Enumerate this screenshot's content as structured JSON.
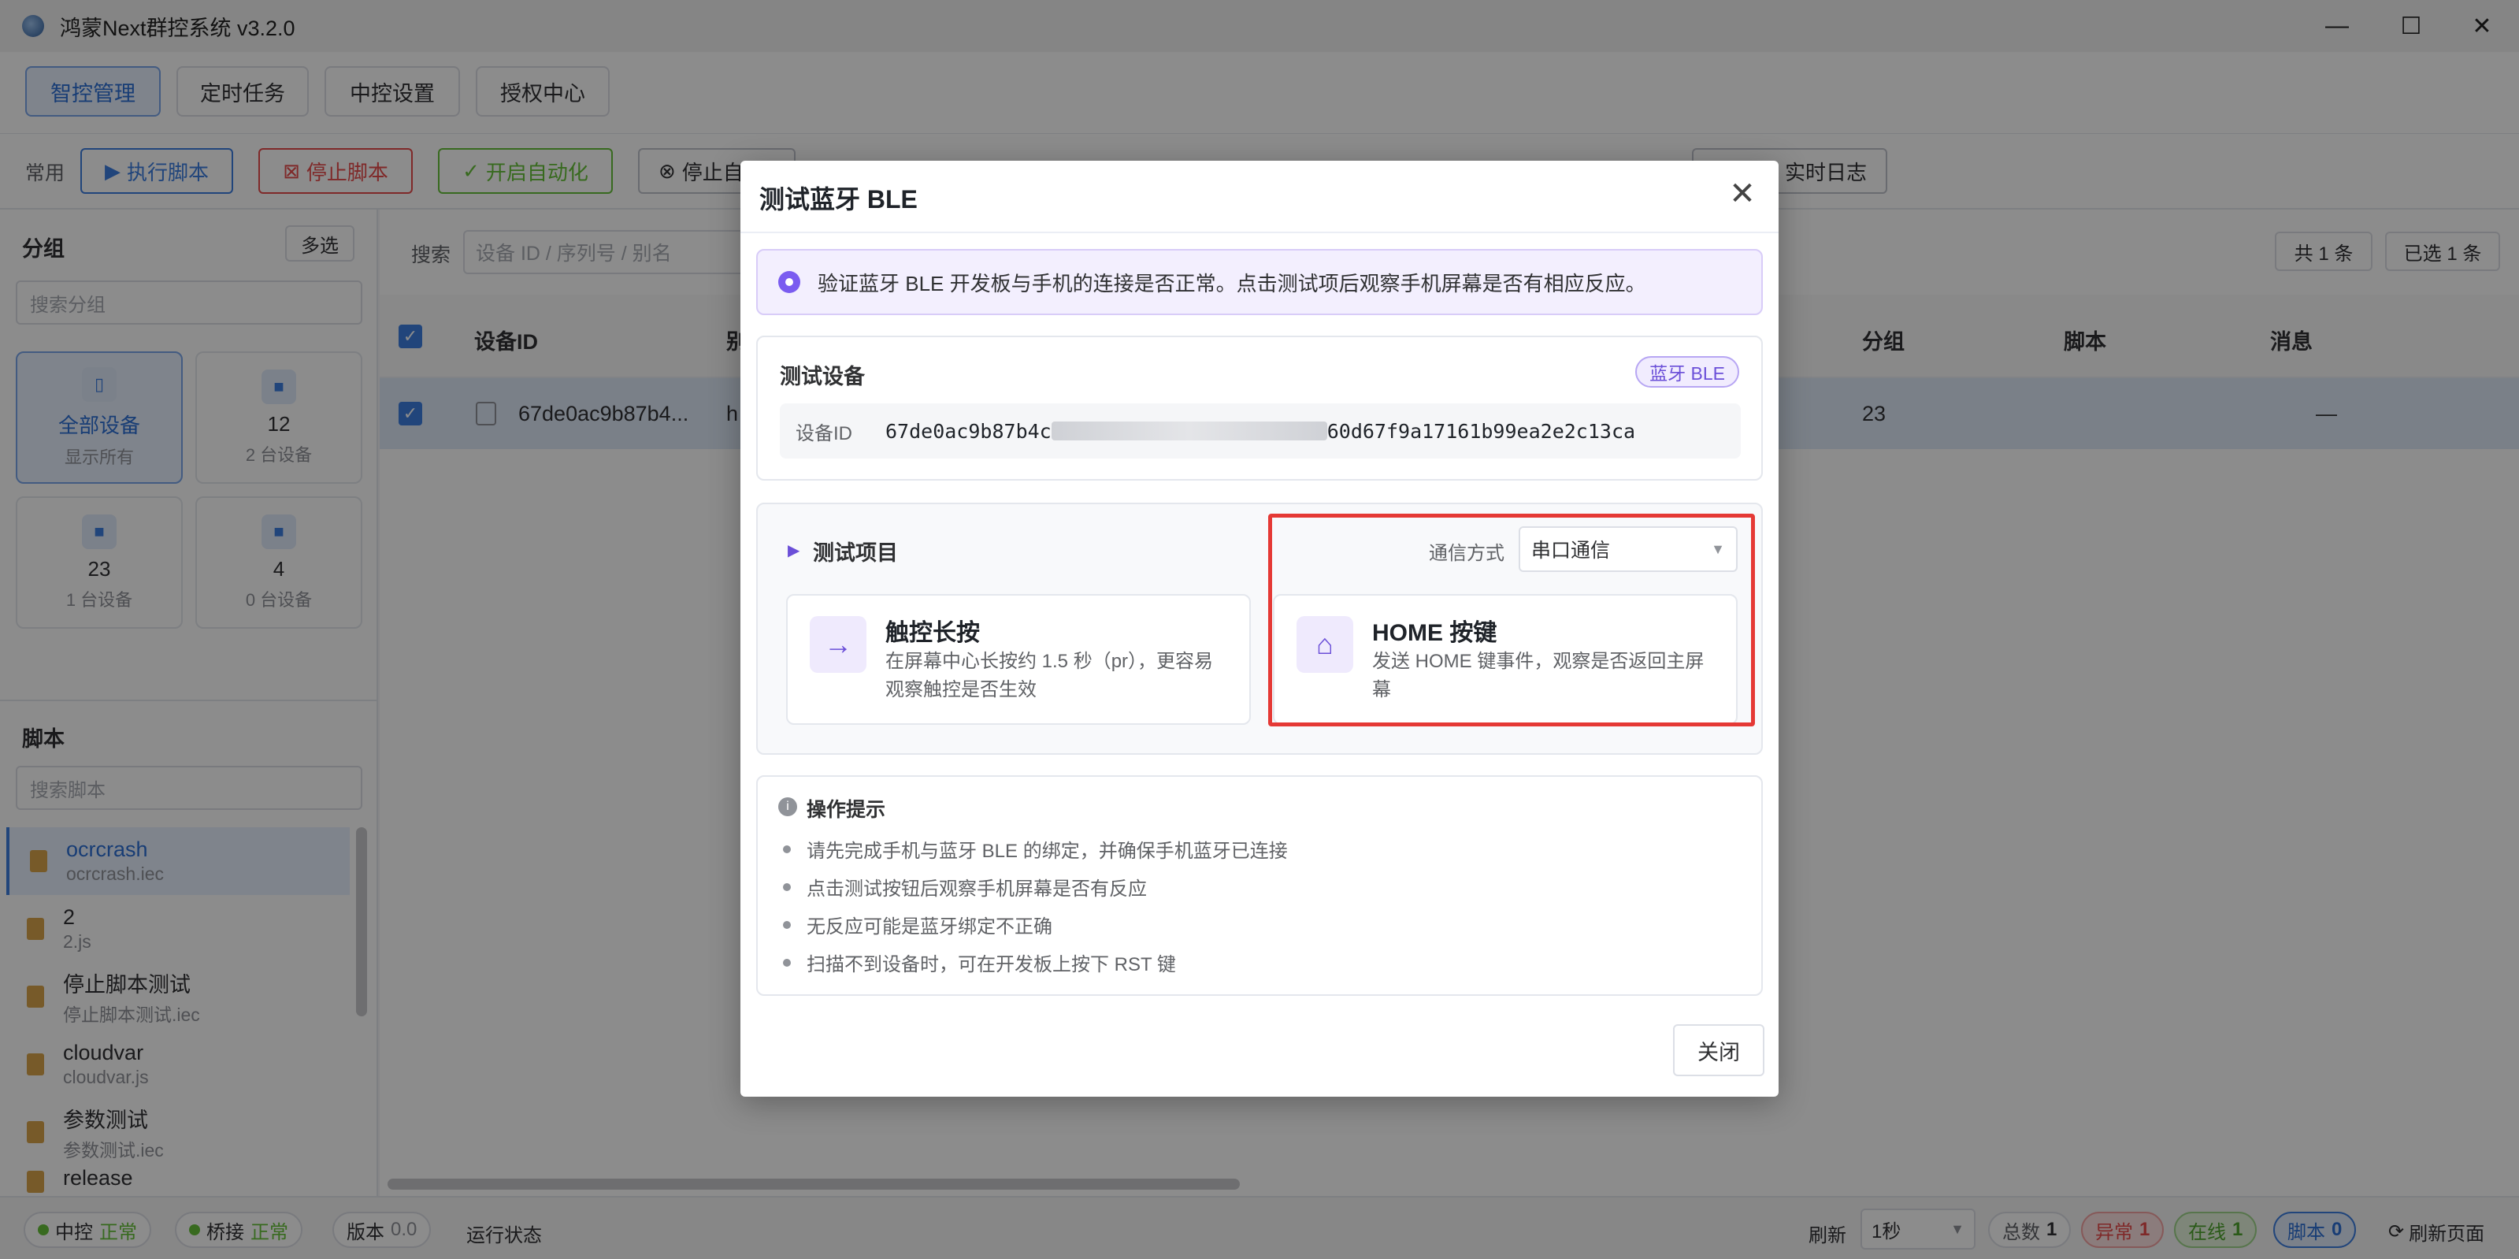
{
  "window": {
    "title": "鸿蒙Next群控系统 v3.2.0",
    "controls": {
      "minimize": "—",
      "maximize": "☐",
      "close": "✕"
    }
  },
  "nav": {
    "tabs": [
      {
        "label": "智控管理",
        "active": true
      },
      {
        "label": "定时任务",
        "active": false
      },
      {
        "label": "中控设置",
        "active": false
      },
      {
        "label": "授权中心",
        "active": false
      }
    ]
  },
  "toolbar": {
    "label": "常用",
    "run_script": "执行脚本",
    "stop_script": "停止脚本",
    "start_auto": "开启自动化",
    "stop_auto": "停止自",
    "realtime_log": "实时日志"
  },
  "sidebar": {
    "group_title": "分组",
    "multi_select": "多选",
    "group_search_placeholder": "搜索分组",
    "groups": [
      {
        "name": "全部设备",
        "sub": "显示所有"
      },
      {
        "name": "12",
        "sub": "2 台设备"
      },
      {
        "name": "23",
        "sub": "1 台设备"
      },
      {
        "name": "4",
        "sub": "0 台设备"
      }
    ],
    "script_title": "脚本",
    "script_search_placeholder": "搜索脚本",
    "scripts": [
      {
        "name": "ocrcrash",
        "file": "ocrcrash.iec"
      },
      {
        "name": "2",
        "file": "2.js"
      },
      {
        "name": "停止脚本测试",
        "file": "停止脚本测试.iec"
      },
      {
        "name": "cloudvar",
        "file": "cloudvar.js"
      },
      {
        "name": "参数测试",
        "file": "参数测试.iec"
      },
      {
        "name": "release",
        "file": ""
      }
    ]
  },
  "main": {
    "search_label": "搜索",
    "search_placeholder": "设备 ID / 序列号 / 别名",
    "total": "共 1 条",
    "selected": "已选 1 条",
    "columns": {
      "device_id": "设备ID",
      "alias": "别",
      "group": "分组",
      "script": "脚本",
      "message": "消息"
    },
    "rows": [
      {
        "device_id": "67de0ac9b87b4...",
        "alias": "h",
        "group": "23",
        "script": "",
        "message": "—"
      }
    ]
  },
  "modal": {
    "title": "测试蓝牙 BLE",
    "close_icon": "✕",
    "alert": "验证蓝牙 BLE 开发板与手机的连接是否正常。点击测试项后观察手机屏幕是否有相应反应。",
    "device_section_title": "测试设备",
    "device_badge": "蓝牙 BLE",
    "device_id_label": "设备ID",
    "device_id_value_start": "67de0ac9b87b4c",
    "device_id_value_end": "60d67f9a17161b99ea2e2c13ca",
    "test_items_title": "测试项目",
    "comm_label": "通信方式",
    "comm_value": "串口通信",
    "tests": [
      {
        "name": "触控长按",
        "desc": "在屏幕中心长按约 1.5 秒（pr），更容易观察触控是否生效",
        "icon": "→"
      },
      {
        "name": "HOME 按键",
        "desc": "发送 HOME 键事件，观察是否返回主屏幕",
        "icon": "⌂"
      }
    ],
    "tips_title": "操作提示",
    "tips": [
      "请先完成手机与蓝牙 BLE 的绑定，并确保手机蓝牙已连接",
      "点击测试按钮后观察手机屏幕是否有反应",
      "无反应可能是蓝牙绑定不正确",
      "扫描不到设备时，可在开发板上按下 RST 键"
    ],
    "close_button": "关闭"
  },
  "statusbar": {
    "central_label": "中控",
    "central_status": "正常",
    "bridge_label": "桥接",
    "bridge_status": "正常",
    "version_label": "版本",
    "version_value": "0.0",
    "run_state": "运行状态",
    "refresh_label": "刷新",
    "refresh_value": "1秒",
    "total_label": "总数",
    "total_value": "1",
    "error_label": "异常",
    "error_value": "1",
    "online_label": "在线",
    "online_value": "1",
    "script_label": "脚本",
    "script_value": "0",
    "refresh_page": "刷新页面"
  },
  "colors": {
    "primary": "#3d7ee0",
    "purple": "#6b4fd8",
    "danger": "#e84b4b",
    "success": "#67c23a",
    "highlight": "#e53935"
  }
}
